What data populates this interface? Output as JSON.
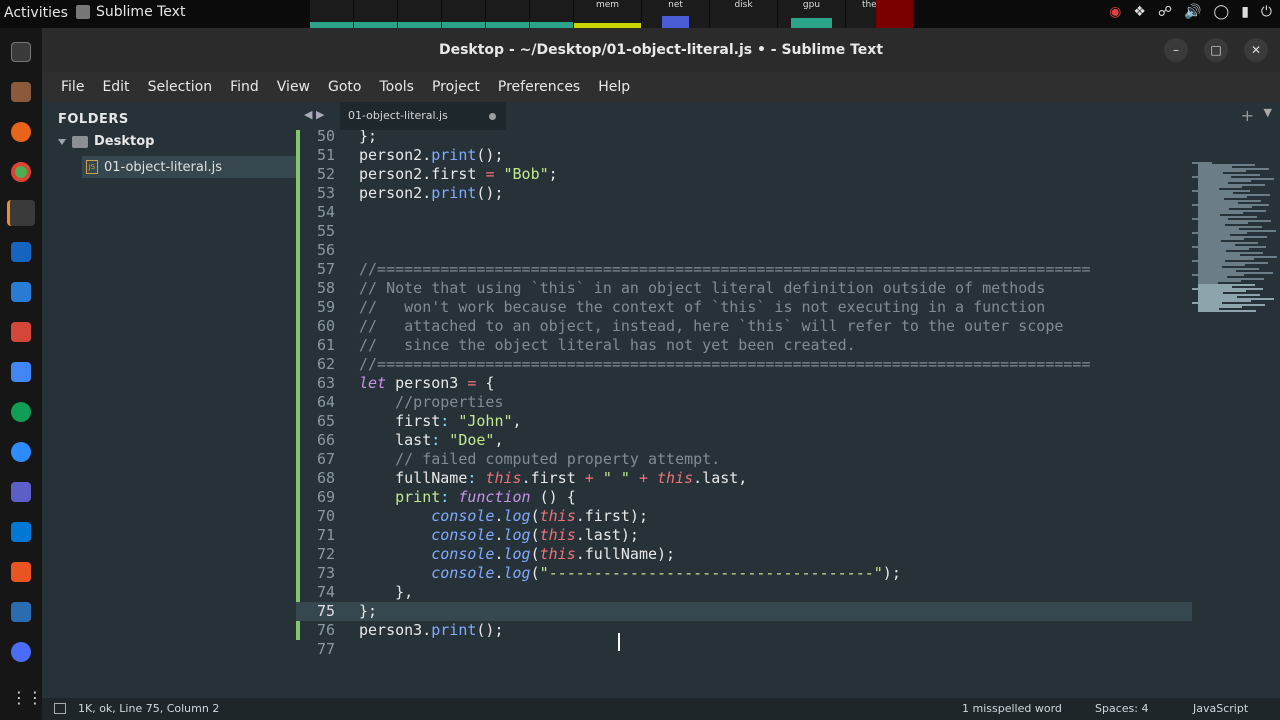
{
  "topbar": {
    "activities": "Activities",
    "app_name": "Sublime Text",
    "monitors": [
      {
        "label": "mem"
      },
      {
        "label": "net"
      },
      {
        "label": "disk"
      },
      {
        "label": "gpu"
      },
      {
        "label": "thermal"
      }
    ]
  },
  "window": {
    "title": "Desktop - ~/Desktop/01-object-literal.js • - Sublime Text",
    "minimize": "–",
    "maximize": "□",
    "close": "✕"
  },
  "menu": [
    "File",
    "Edit",
    "Selection",
    "Find",
    "View",
    "Goto",
    "Tools",
    "Project",
    "Preferences",
    "Help"
  ],
  "sidebar": {
    "heading": "FOLDERS",
    "folder": "Desktop",
    "file": "01-object-literal.js",
    "file_icon": "JS"
  },
  "tabs": {
    "active": "01-object-literal.js",
    "nav": "◀ ▶",
    "plus": "+",
    "down": "▼"
  },
  "editor": {
    "current_line": 75,
    "lines": [
      {
        "n": "50",
        "tokens": [
          [
            "plain",
            "};"
          ]
        ]
      },
      {
        "n": "51",
        "tokens": [
          [
            "plain",
            "person2."
          ],
          [
            "method",
            "print"
          ],
          [
            "plain",
            "();"
          ]
        ]
      },
      {
        "n": "52",
        "tokens": [
          [
            "plain",
            "person2.first "
          ],
          [
            "this",
            "="
          ],
          [
            "string",
            " \"Bob\""
          ],
          [
            "plain",
            ";"
          ]
        ]
      },
      {
        "n": "53",
        "tokens": [
          [
            "plain",
            "person2."
          ],
          [
            "method",
            "print"
          ],
          [
            "plain",
            "();"
          ]
        ]
      },
      {
        "n": "54",
        "tokens": []
      },
      {
        "n": "55",
        "tokens": []
      },
      {
        "n": "56",
        "tokens": []
      },
      {
        "n": "57",
        "tokens": [
          [
            "comment",
            "//==============================================================================="
          ]
        ]
      },
      {
        "n": "58",
        "tokens": [
          [
            "comment",
            "// Note that using `this` in an object literal definition outside of methods"
          ]
        ]
      },
      {
        "n": "59",
        "tokens": [
          [
            "comment",
            "//   won't work because the context of `this` is not executing in a function"
          ]
        ]
      },
      {
        "n": "60",
        "tokens": [
          [
            "comment",
            "//   attached to an object, instead, here `this` will refer to the outer scope"
          ]
        ]
      },
      {
        "n": "61",
        "tokens": [
          [
            "comment",
            "//   since the object literal has not yet been created."
          ]
        ]
      },
      {
        "n": "62",
        "tokens": [
          [
            "comment",
            "//==============================================================================="
          ]
        ]
      },
      {
        "n": "63",
        "tokens": [
          [
            "keyword",
            "let"
          ],
          [
            "plain",
            " person3 "
          ],
          [
            "this",
            "="
          ],
          [
            "plain",
            " {"
          ]
        ]
      },
      {
        "n": "64",
        "tokens": [
          [
            "plain",
            "    "
          ],
          [
            "comment",
            "//properties"
          ]
        ]
      },
      {
        "n": "65",
        "tokens": [
          [
            "plain",
            "    first"
          ],
          [
            "punc",
            ":"
          ],
          [
            "string",
            " \"John\""
          ],
          [
            "plain",
            ","
          ]
        ]
      },
      {
        "n": "66",
        "tokens": [
          [
            "plain",
            "    last"
          ],
          [
            "punc",
            ":"
          ],
          [
            "string",
            " \"Doe\""
          ],
          [
            "plain",
            ","
          ]
        ]
      },
      {
        "n": "67",
        "tokens": [
          [
            "plain",
            "    "
          ],
          [
            "comment",
            "// failed computed property attempt."
          ]
        ]
      },
      {
        "n": "68",
        "tokens": [
          [
            "plain",
            "    fullName"
          ],
          [
            "punc",
            ":"
          ],
          [
            "plain",
            " "
          ],
          [
            "this",
            "this"
          ],
          [
            "plain",
            ".first "
          ],
          [
            "this",
            "+"
          ],
          [
            "string",
            " \" \" "
          ],
          [
            "this",
            "+"
          ],
          [
            "plain",
            " "
          ],
          [
            "this",
            "this"
          ],
          [
            "plain",
            ".last,"
          ]
        ]
      },
      {
        "n": "69",
        "tokens": [
          [
            "plain",
            "    "
          ],
          [
            "key",
            "print"
          ],
          [
            "punc",
            ":"
          ],
          [
            "plain",
            " "
          ],
          [
            "keyword",
            "function"
          ],
          [
            "plain",
            " () {"
          ]
        ]
      },
      {
        "n": "70",
        "tokens": [
          [
            "plain",
            "        "
          ],
          [
            "console",
            "console"
          ],
          [
            "plain",
            "."
          ],
          [
            "console",
            "log"
          ],
          [
            "plain",
            "("
          ],
          [
            "this",
            "this"
          ],
          [
            "plain",
            ".first);"
          ]
        ]
      },
      {
        "n": "71",
        "tokens": [
          [
            "plain",
            "        "
          ],
          [
            "console",
            "console"
          ],
          [
            "plain",
            "."
          ],
          [
            "console",
            "log"
          ],
          [
            "plain",
            "("
          ],
          [
            "this",
            "this"
          ],
          [
            "plain",
            ".last);"
          ]
        ]
      },
      {
        "n": "72",
        "tokens": [
          [
            "plain",
            "        "
          ],
          [
            "console",
            "console"
          ],
          [
            "plain",
            "."
          ],
          [
            "console",
            "log"
          ],
          [
            "plain",
            "("
          ],
          [
            "this",
            "this"
          ],
          [
            "plain",
            ".fullName);"
          ]
        ]
      },
      {
        "n": "73",
        "tokens": [
          [
            "plain",
            "        "
          ],
          [
            "console",
            "console"
          ],
          [
            "plain",
            "."
          ],
          [
            "console",
            "log"
          ],
          [
            "plain",
            "("
          ],
          [
            "string",
            "\"------------------------------------\""
          ],
          [
            "plain",
            ");"
          ]
        ]
      },
      {
        "n": "74",
        "tokens": [
          [
            "plain",
            "    },"
          ]
        ]
      },
      {
        "n": "75",
        "tokens": [
          [
            "plain",
            "};"
          ]
        ]
      },
      {
        "n": "76",
        "tokens": [
          [
            "plain",
            "person3."
          ],
          [
            "method",
            "print"
          ],
          [
            "plain",
            "();"
          ]
        ]
      },
      {
        "n": "77",
        "tokens": []
      }
    ]
  },
  "status": {
    "left": "1K, ok, Line 75, Column 2",
    "spell": "1 misspelled word",
    "spaces": "Spaces: 4",
    "syntax": "JavaScript"
  },
  "colors": {
    "editor_bg": "#263238",
    "current_line": "#37474f",
    "modified_marker": "#82c76c"
  }
}
